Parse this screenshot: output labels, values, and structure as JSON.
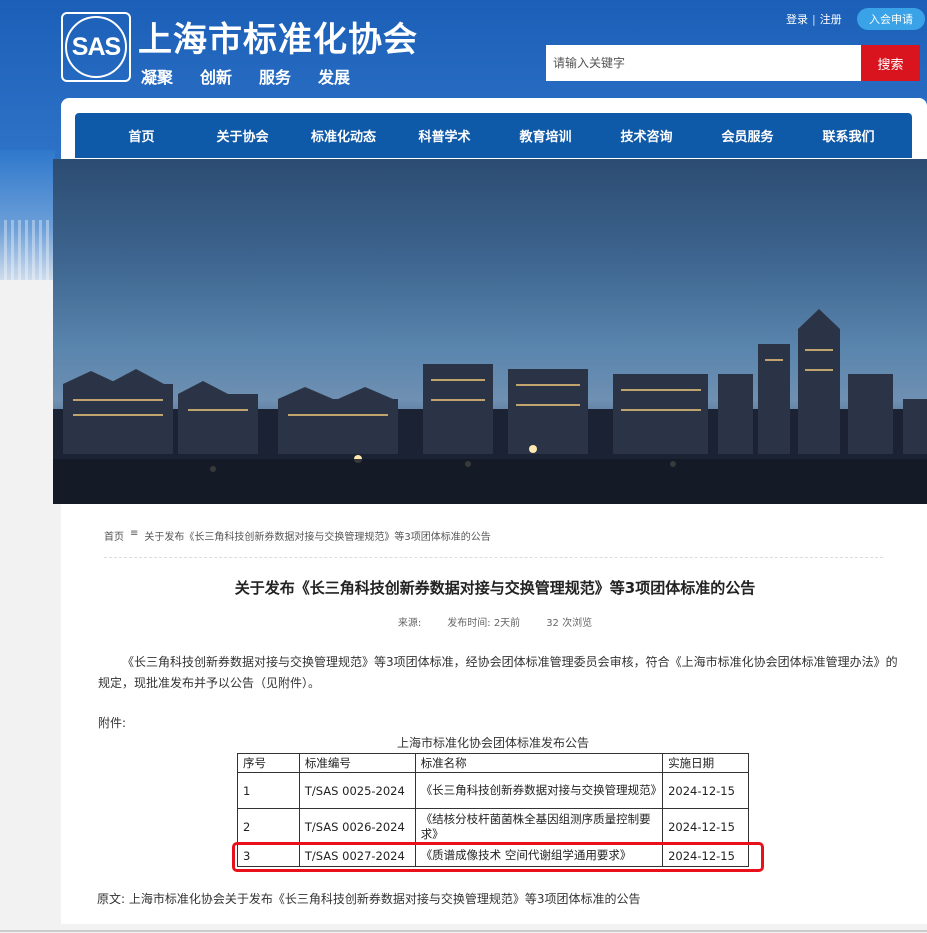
{
  "header": {
    "logo_text": "SAS",
    "site_title": "上海市标准化协会",
    "slogans": [
      "凝聚",
      "创新",
      "服务",
      "发展"
    ],
    "login": "登录",
    "separator": "|",
    "register": "注册",
    "join": "入会申请",
    "search_placeholder": "请输入关键字",
    "search_button": "搜索"
  },
  "nav": {
    "items": [
      "首页",
      "关于协会",
      "标准化动态",
      "科普学术",
      "教育培训",
      "技术咨询",
      "会员服务",
      "联系我们"
    ]
  },
  "breadcrumb": {
    "home": "首页",
    "separator": "≡",
    "current": "关于发布《长三角科技创新券数据对接与交换管理规范》等3项团体标准的公告"
  },
  "article": {
    "title": "关于发布《长三角科技创新券数据对接与交换管理规范》等3项团体标准的公告",
    "source_label": "来源:",
    "publish_time": "发布时间: 2天前",
    "views": "32 次浏览",
    "paragraph": "《长三角科技创新券数据对接与交换管理规范》等3项团体标准，经协会团体标准管理委员会审核，符合《上海市标准化协会团体标准管理办法》的规定，现批准发布并予以公告（见附件）。",
    "attachment_label": "附件:",
    "original": "原文: 上海市标准化协会关于发布《长三角科技创新券数据对接与交换管理规范》等3项团体标准的公告"
  },
  "table": {
    "caption": "上海市标准化协会团体标准发布公告",
    "headers": [
      "序号",
      "标准编号",
      "标准名称",
      "实施日期"
    ],
    "rows": [
      {
        "num": "1",
        "code": "T/SAS 0025-2024",
        "name": "《长三角科技创新券数据对接与交换管理规范》",
        "date": "2024-12-15"
      },
      {
        "num": "2",
        "code": "T/SAS 0026-2024",
        "name": "《结核分枝杆菌菌株全基因组测序质量控制要求》",
        "date": "2024-12-15"
      },
      {
        "num": "3",
        "code": "T/SAS 0027-2024",
        "name": "《质谱成像技术 空间代谢组学通用要求》",
        "date": "2024-12-15"
      }
    ]
  },
  "colors": {
    "header_blue": "#1b5fb8",
    "nav_blue": "#0f5aa8",
    "search_red": "#d9141f",
    "join_blue": "#3aa2e6",
    "highlight_red": "#e8101a"
  }
}
